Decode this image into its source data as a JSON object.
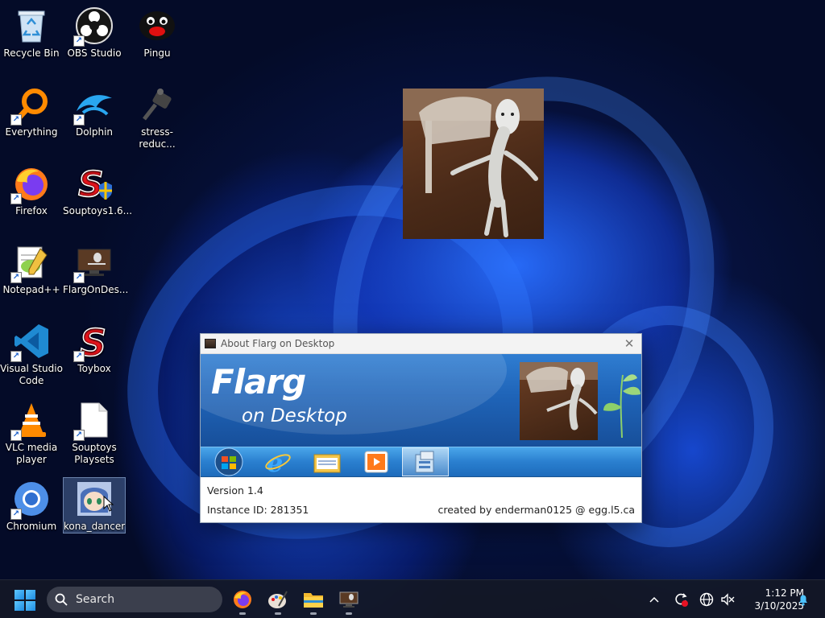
{
  "desktop": {
    "icons": [
      {
        "label": "Recycle Bin",
        "icon": "recycle-bin-icon"
      },
      {
        "label": "OBS Studio",
        "icon": "obs-icon"
      },
      {
        "label": "Pingu",
        "icon": "pingu-icon"
      },
      {
        "label": "Everything",
        "icon": "everything-search-icon"
      },
      {
        "label": "Dolphin",
        "icon": "dolphin-icon"
      },
      {
        "label": "stress-reduc...",
        "icon": "stress-reducer-icon"
      },
      {
        "label": "Firefox",
        "icon": "firefox-icon"
      },
      {
        "label": "Souptoys1.6...",
        "icon": "souptoys-installer-icon"
      },
      {
        "label": "Notepad++",
        "icon": "notepadpp-icon"
      },
      {
        "label": "FlargOnDes...",
        "icon": "flarg-icon"
      },
      {
        "label": "Visual Studio Code",
        "icon": "vscode-icon"
      },
      {
        "label": "Toybox",
        "icon": "toybox-icon"
      },
      {
        "label": "VLC media player",
        "icon": "vlc-icon"
      },
      {
        "label": "Souptoys Playsets",
        "icon": "file-icon"
      },
      {
        "label": "Chromium",
        "icon": "chromium-icon"
      },
      {
        "label": "kona_dancer",
        "icon": "kona-dancer-icon"
      }
    ]
  },
  "about_dialog": {
    "title": "About Flarg on Desktop",
    "banner_title": "Flarg",
    "banner_subtitle": "on Desktop",
    "version": "Version 1.4",
    "instance": "Instance ID: 281351",
    "credit": "created by enderman0125 @ egg.l5.ca"
  },
  "taskbar": {
    "search_placeholder": "Search",
    "apps": [
      "firefox-icon",
      "paint-icon",
      "file-explorer-icon",
      "flarg-icon"
    ],
    "time": "1:12 PM",
    "date": "3/10/2025"
  },
  "colors": {
    "banner": "#1f64b8",
    "taskbar": "#14182a",
    "accent": "#1e8be0"
  }
}
